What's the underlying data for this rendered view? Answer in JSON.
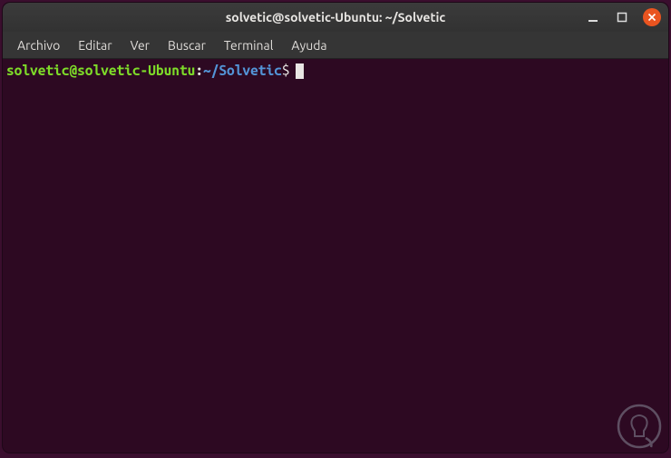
{
  "window": {
    "title": "solvetic@solvetic-Ubuntu: ~/Solvetic"
  },
  "menubar": {
    "items": [
      {
        "label": "Archivo"
      },
      {
        "label": "Editar"
      },
      {
        "label": "Ver"
      },
      {
        "label": "Buscar"
      },
      {
        "label": "Terminal"
      },
      {
        "label": "Ayuda"
      }
    ]
  },
  "prompt": {
    "user_host": "solvetic@solvetic-Ubuntu",
    "colon": ":",
    "path": "~/Solvetic",
    "symbol": "$"
  },
  "colors": {
    "titlebar_bg": "#323232",
    "menubar_bg": "#353535",
    "terminal_bg": "#2d0922",
    "prompt_user": "#7edb29",
    "prompt_path": "#5394d6",
    "close_btn": "#e95420"
  }
}
